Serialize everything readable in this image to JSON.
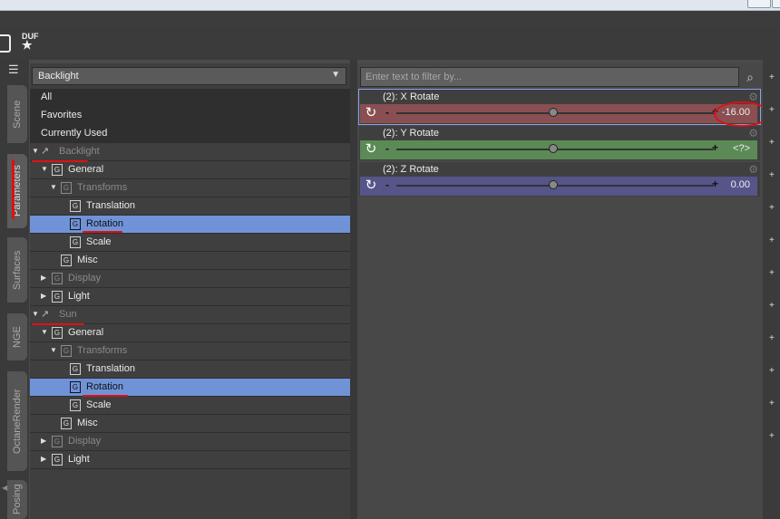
{
  "colors": {
    "accent_select": "#7093d8",
    "x_bar": "#8a4f52",
    "y_bar": "#5b8a57",
    "z_bar": "#55558a",
    "annotation": "#e01010"
  },
  "toolbar": {
    "icons": [
      "figure-icon",
      "duf-file-icon"
    ],
    "duf_label": "DUF"
  },
  "side_tabs": [
    "Scene",
    "Parameters",
    "Surfaces",
    "NGE",
    "OctaneRender",
    "Posing"
  ],
  "left_panel": {
    "dropdown_value": "Backlight",
    "top_rows": [
      "All",
      "Favorites",
      "Currently Used"
    ],
    "tree": [
      {
        "label": "Backlight",
        "kind": "light"
      },
      {
        "label": "General"
      },
      {
        "label": "Transforms"
      },
      {
        "label": "Translation"
      },
      {
        "label": "Rotation",
        "selected": true
      },
      {
        "label": "Scale"
      },
      {
        "label": "Misc"
      },
      {
        "label": "Display"
      },
      {
        "label": "Light"
      },
      {
        "label": "Sun",
        "kind": "light"
      },
      {
        "label": "General"
      },
      {
        "label": "Transforms"
      },
      {
        "label": "Translation"
      },
      {
        "label": "Rotation",
        "selected": true
      },
      {
        "label": "Scale"
      },
      {
        "label": "Misc"
      },
      {
        "label": "Display"
      },
      {
        "label": "Light"
      }
    ]
  },
  "right_panel": {
    "filter_placeholder": "Enter text to filter by...",
    "params": [
      {
        "name": "(2): X Rotate",
        "value": "-16.00",
        "slider_fraction": 0.5
      },
      {
        "name": "(2): Y Rotate",
        "value": "<?>",
        "slider_fraction": 0.5
      },
      {
        "name": "(2): Z Rotate",
        "value": "0.00",
        "slider_fraction": 0.5
      }
    ],
    "minus_label": "-",
    "plus_label": "+"
  }
}
